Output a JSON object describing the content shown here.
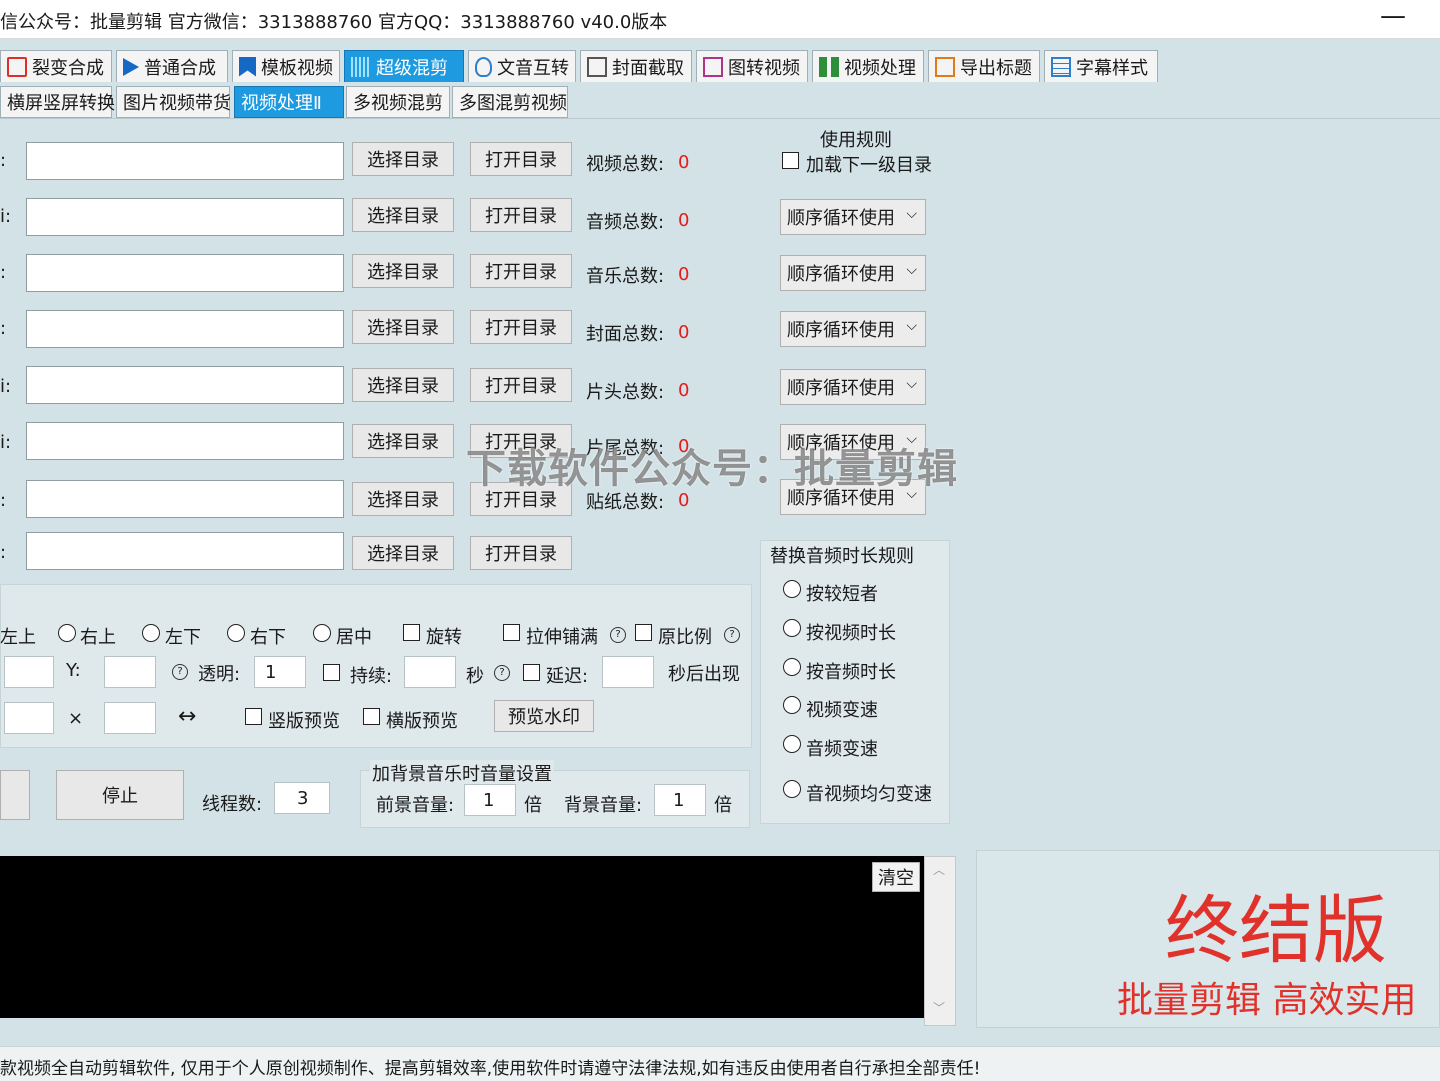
{
  "window": {
    "title": "信公众号：批量剪辑  官方微信：3313888760  官方QQ：3313888760   v40.0版本",
    "minimize": "—"
  },
  "tabs_main": [
    {
      "label": "裂变合成",
      "icon": "split-icon"
    },
    {
      "label": "普通合成",
      "icon": "play-icon"
    },
    {
      "label": "模板视频",
      "icon": "template-icon"
    },
    {
      "label": "超级混剪",
      "icon": "waveform-icon"
    },
    {
      "label": "文音互转",
      "icon": "microphone-icon"
    },
    {
      "label": "封面截取",
      "icon": "image-icon"
    },
    {
      "label": "图转视频",
      "icon": "film-icon"
    },
    {
      "label": "视频处理",
      "icon": "video-process-icon"
    },
    {
      "label": "导出标题",
      "icon": "export-icon"
    },
    {
      "label": "字幕样式",
      "icon": "subtitle-icon"
    }
  ],
  "tabs_sub": [
    "横屏竖屏转换",
    "图片视频带货",
    "视频处理Ⅱ",
    "多视频混剪",
    "多图混剪视频"
  ],
  "folder_rows": [
    {
      "prefix": ":",
      "select": "选择目录",
      "open": "打开目录",
      "count_label": "视频总数:",
      "count": "0"
    },
    {
      "prefix": "i:",
      "select": "选择目录",
      "open": "打开目录",
      "count_label": "音频总数:",
      "count": "0"
    },
    {
      "prefix": ":",
      "select": "选择目录",
      "open": "打开目录",
      "count_label": "音乐总数:",
      "count": "0"
    },
    {
      "prefix": ":",
      "select": "选择目录",
      "open": "打开目录",
      "count_label": "封面总数:",
      "count": "0"
    },
    {
      "prefix": "i:",
      "select": "选择目录",
      "open": "打开目录",
      "count_label": "片头总数:",
      "count": "0"
    },
    {
      "prefix": "i:",
      "select": "选择目录",
      "open": "打开目录",
      "count_label": "片尾总数:",
      "count": "0"
    },
    {
      "prefix": ":",
      "select": "选择目录",
      "open": "打开目录",
      "count_label": "贴纸总数:",
      "count": "0"
    },
    {
      "prefix": ":",
      "select": "选择目录",
      "open": "打开目录",
      "count_label": "",
      "count": ""
    }
  ],
  "rules": {
    "title": "使用规则",
    "load_subdir": "加载下一级目录",
    "dropdowns": [
      "顺序循环使用",
      "顺序循环使用",
      "顺序循环使用",
      "顺序循环使用",
      "顺序循环使用",
      "顺序循环使用"
    ]
  },
  "watermark_overlay": "下载软件公众号：批量剪辑",
  "position": {
    "options": [
      "左上",
      "右上",
      "左下",
      "右下",
      "居中"
    ],
    "rotate": "旋转",
    "stretch": "拉伸铺满",
    "original_ratio": "原比例",
    "y_label": "Y:",
    "opacity_label": "透明:",
    "opacity_value": "1",
    "duration_label": "持续:",
    "seconds": "秒",
    "delay_label": "延迟:",
    "appear_after": "秒后出现",
    "times": "×",
    "swap": "↔",
    "vertical_preview": "竖版预览",
    "horizontal_preview": "横版预览",
    "preview_watermark": "预览水印"
  },
  "controls": {
    "stop": "停止",
    "threads_label": "线程数:",
    "threads_value": "3"
  },
  "bg_music": {
    "title": "加背景音乐时音量设置",
    "fg_label": "前景音量:",
    "fg_value": "1",
    "fg_unit": "倍",
    "bg_label": "背景音量:",
    "bg_value": "1",
    "bg_unit": "倍"
  },
  "audio_rule": {
    "title": "替换音频时长规则",
    "options": [
      "按较短者",
      "按视频时长",
      "按音频时长",
      "视频变速",
      "音频变速",
      "音视频均匀变速"
    ]
  },
  "console": {
    "clear": "清空"
  },
  "promo": {
    "title": "终结版",
    "subtitle": "批量剪辑 高效实用",
    "color": "#e0322a"
  },
  "status_bar": "款视频全自动剪辑软件,  仅用于个人原创视频制作、提高剪辑效率,使用软件时请遵守法律法规,如有违反由使用者自行承担全部责任!"
}
